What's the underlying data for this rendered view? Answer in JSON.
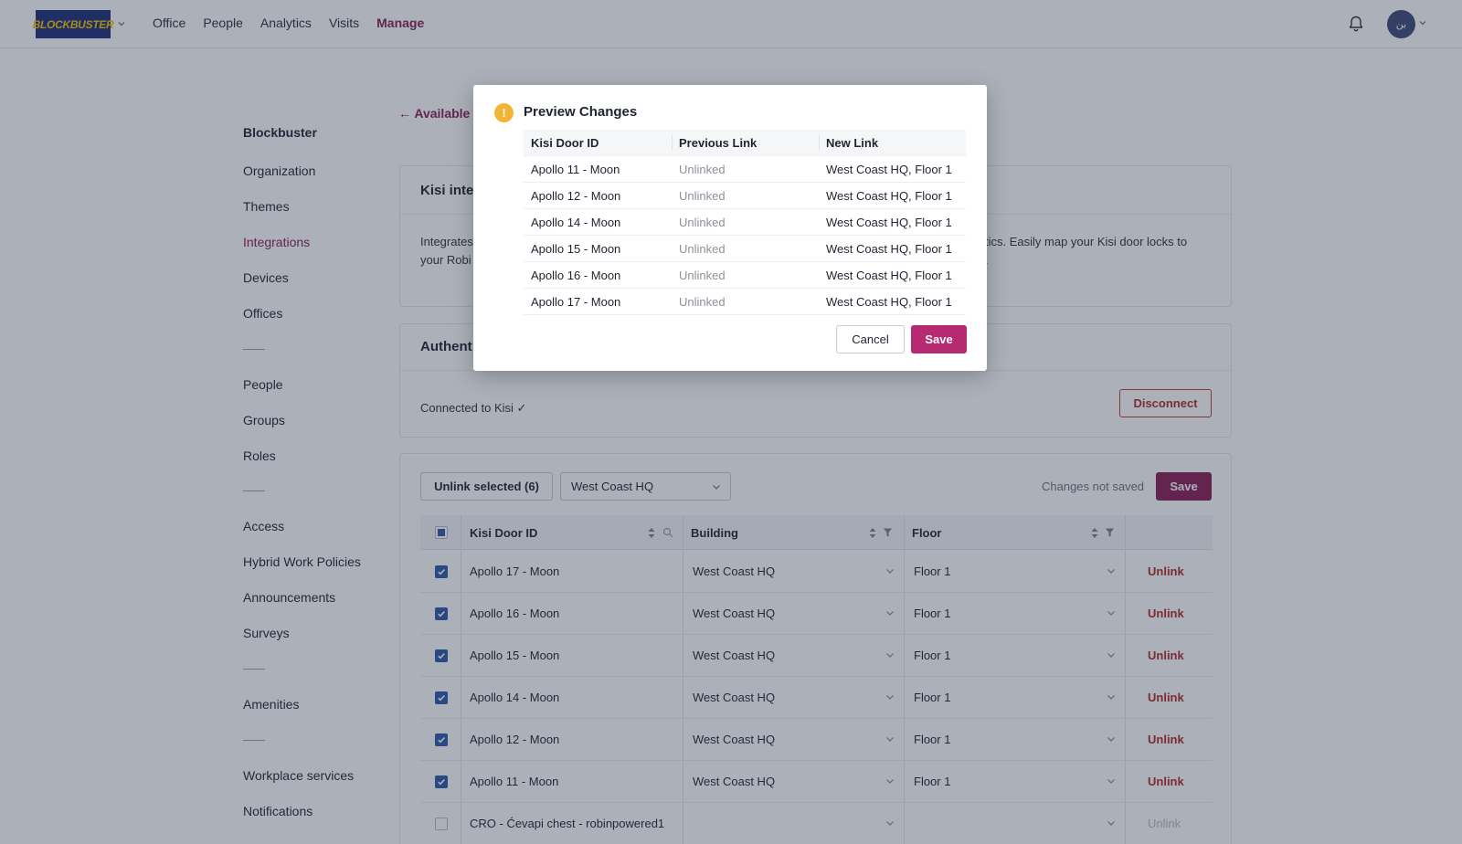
{
  "brand": {
    "logo_text": "BLOCKBUSTER"
  },
  "nav": {
    "items": [
      "Office",
      "People",
      "Analytics",
      "Visits",
      "Manage"
    ],
    "active": "Manage"
  },
  "user": {
    "avatar_initials": "بن"
  },
  "sidebar": {
    "org_name": "Blockbuster",
    "group1": [
      "Organization",
      "Themes",
      "Integrations",
      "Devices",
      "Offices"
    ],
    "group2": [
      "People",
      "Groups",
      "Roles"
    ],
    "group3": [
      "Access",
      "Hybrid Work Policies",
      "Announcements",
      "Surveys"
    ],
    "group4": [
      "Amenities"
    ],
    "group5": [
      "Workplace services",
      "Notifications"
    ],
    "active": "Integrations"
  },
  "main": {
    "back_link": "← Available",
    "intro_card": {
      "title": "Kisi integ",
      "text_line1_left": "Integrates",
      "text_line1_right": "tics. Easily map your Kisi door locks to",
      "text_line2_left": "your Robi",
      "text_line2_right": "."
    },
    "auth_card": {
      "title": "Authent",
      "status": "Connected to Kisi ✓",
      "disconnect_label": "Disconnect"
    },
    "toolbar": {
      "unlink_selected_label": "Unlink selected (6)",
      "building_select_value": "West Coast HQ",
      "unsaved_text": "Changes not saved",
      "save_label": "Save"
    },
    "table": {
      "columns": [
        "Kisi Door ID",
        "Building",
        "Floor"
      ],
      "rows": [
        {
          "id": "Apollo 17 - Moon",
          "building": "West Coast HQ",
          "floor": "Floor 1",
          "checked": true,
          "action": "Unlink"
        },
        {
          "id": "Apollo 16 - Moon",
          "building": "West Coast HQ",
          "floor": "Floor 1",
          "checked": true,
          "action": "Unlink"
        },
        {
          "id": "Apollo 15 - Moon",
          "building": "West Coast HQ",
          "floor": "Floor 1",
          "checked": true,
          "action": "Unlink"
        },
        {
          "id": "Apollo 14 - Moon",
          "building": "West Coast HQ",
          "floor": "Floor 1",
          "checked": true,
          "action": "Unlink"
        },
        {
          "id": "Apollo 12 - Moon",
          "building": "West Coast HQ",
          "floor": "Floor 1",
          "checked": true,
          "action": "Unlink"
        },
        {
          "id": "Apollo 11 - Moon",
          "building": "West Coast HQ",
          "floor": "Floor 1",
          "checked": true,
          "action": "Unlink"
        },
        {
          "id": "CRO - Ćevapi chest - robinpowered1",
          "building": "",
          "floor": "",
          "checked": false,
          "action": "Unlink"
        }
      ]
    }
  },
  "modal": {
    "title": "Preview Changes",
    "warning_glyph": "!",
    "columns": [
      "Kisi Door ID",
      "Previous Link",
      "New Link"
    ],
    "rows": [
      {
        "id": "Apollo 11 - Moon",
        "previous": "Unlinked",
        "new": "West Coast HQ, Floor 1"
      },
      {
        "id": "Apollo 12 - Moon",
        "previous": "Unlinked",
        "new": "West Coast HQ, Floor 1"
      },
      {
        "id": "Apollo 14 - Moon",
        "previous": "Unlinked",
        "new": "West Coast HQ, Floor 1"
      },
      {
        "id": "Apollo 15 - Moon",
        "previous": "Unlinked",
        "new": "West Coast HQ, Floor 1"
      },
      {
        "id": "Apollo 16 - Moon",
        "previous": "Unlinked",
        "new": "West Coast HQ, Floor 1"
      },
      {
        "id": "Apollo 17 - Moon",
        "previous": "Unlinked",
        "new": "West Coast HQ, Floor 1"
      }
    ],
    "cancel_label": "Cancel",
    "save_label": "Save"
  },
  "colors": {
    "brand_primary": "#8a1f56",
    "danger": "#b02a2a",
    "checkbox_checked": "#2e5aa8",
    "warning": "#f5b335",
    "logo_bg": "#1c2f7a",
    "logo_text": "#f5c400"
  }
}
